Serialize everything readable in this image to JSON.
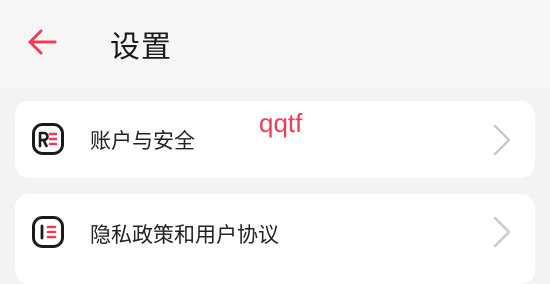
{
  "header": {
    "title": "设置",
    "back_icon": "arrow-left-icon"
  },
  "settings": {
    "items": [
      {
        "label": "账户与安全",
        "icon": "account-security-icon"
      },
      {
        "label": "隐私政策和用户协议",
        "icon": "privacy-policy-icon"
      }
    ]
  },
  "overlay_text": "qqtf",
  "colors": {
    "accent": "#e8405a",
    "background": "#f3f3f3",
    "card": "#ffffff",
    "chevron": "#c8c8c8"
  }
}
